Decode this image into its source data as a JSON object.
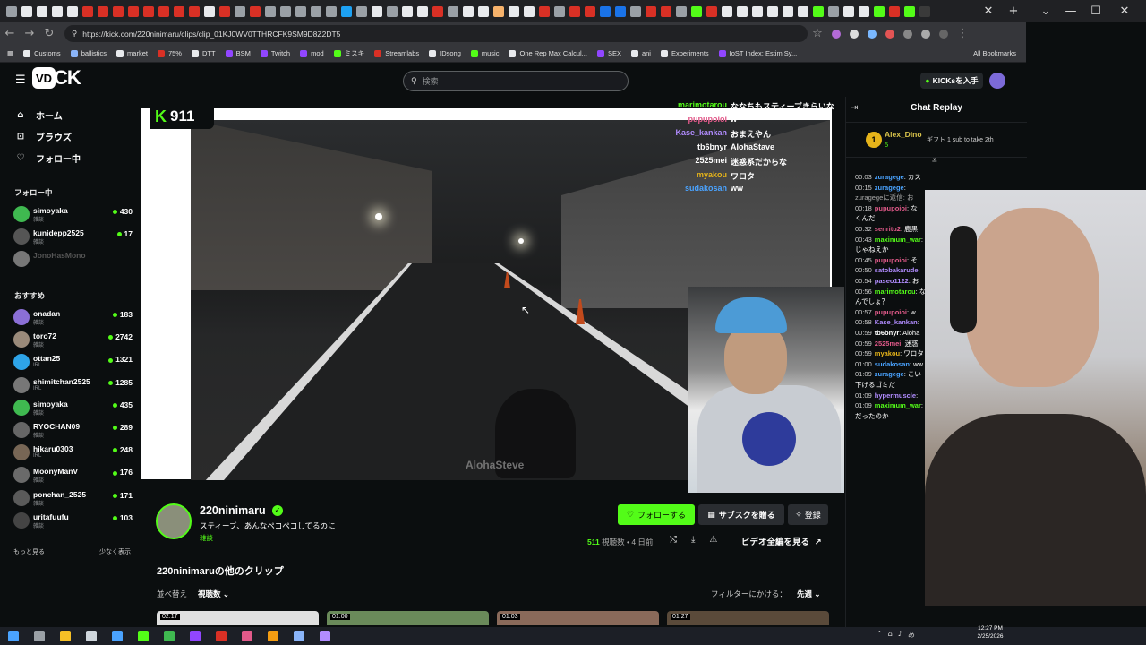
{
  "browser": {
    "url": "https://kick.com/220ninimaru/clips/clip_01KJ0WV0TTHRCFK9SM9D8Z2DT5",
    "bookmarks": [
      "Customs",
      "ballistics",
      "market",
      "75%",
      "DTT",
      "BSM",
      "Twitch",
      "mod",
      "ミスキ",
      "Streamlabs",
      "IDsong",
      "music",
      "One Rep Max Calcul...",
      "SEX",
      "ani",
      "Experiments",
      "IoST Index: Estim Sy..."
    ],
    "all_bookmarks": "All Bookmarks"
  },
  "kick": {
    "search_placeholder": "検索",
    "get_kicks": "KICKsを入手"
  },
  "sidebar": {
    "nav": [
      {
        "icon": "home-icon",
        "label": "ホーム"
      },
      {
        "icon": "browse-icon",
        "label": "ブラウズ"
      },
      {
        "icon": "heart-icon",
        "label": "フォロー中"
      }
    ],
    "following_title": "フォロー中",
    "following": [
      {
        "name": "simoyaka",
        "cat": "雑談",
        "viewers": "430"
      },
      {
        "name": "kunidepp2525",
        "cat": "雑談",
        "viewers": "17"
      },
      {
        "name": "JonoHasMono",
        "cat": "",
        "viewers": ""
      }
    ],
    "recommended_title": "おすすめ",
    "recommended": [
      {
        "name": "onadan",
        "cat": "雑談",
        "viewers": "183"
      },
      {
        "name": "toro72",
        "cat": "雑談",
        "viewers": "2742"
      },
      {
        "name": "ottan25",
        "cat": "IRL",
        "viewers": "1321"
      },
      {
        "name": "shimitchan2525",
        "cat": "IRL",
        "viewers": "1285"
      },
      {
        "name": "simoyaka",
        "cat": "雑談",
        "viewers": "435"
      },
      {
        "name": "RYOCHAN09",
        "cat": "雑談",
        "viewers": "289"
      },
      {
        "name": "hikaru0303",
        "cat": "IRL",
        "viewers": "248"
      },
      {
        "name": "MoonyManV",
        "cat": "雑談",
        "viewers": "176"
      },
      {
        "name": "ponchan_2525",
        "cat": "雑談",
        "viewers": "171"
      },
      {
        "name": "uritafuufu",
        "cat": "雑談",
        "viewers": "103"
      }
    ],
    "show_more": "もっと見る",
    "show_less": "少なく表示"
  },
  "video": {
    "kick_badge_number": "911",
    "watermark": "AlohaSteve",
    "overlay_chat": [
      {
        "user": "marimotarou",
        "msg": "ななちもスティーブきらいな",
        "color": "#53fc18"
      },
      {
        "user": "pupupoioi",
        "msg": "w",
        "color": "#e25a8a"
      },
      {
        "user": "Kase_kankan",
        "msg": "おまえやん",
        "color": "#b18cff"
      },
      {
        "user": "tb6bnyr",
        "msg": "AlohaStave",
        "color": "#ffffff"
      },
      {
        "user": "2525mei",
        "msg": "迷惑系だからな",
        "color": "#ffffff"
      },
      {
        "user": "myakou",
        "msg": "ワロタ",
        "color": "#e6b41a"
      },
      {
        "user": "sudakosan",
        "msg": "ww",
        "color": "#4aa3ff"
      }
    ]
  },
  "channel": {
    "name": "220ninimaru",
    "title": "スティーブ、あんなペコペコしてるのに",
    "category": "雑談",
    "follow": "フォローする",
    "gift_sub": "サブスクを贈る",
    "register": "登録",
    "views_count": "511",
    "views_label": "視聴数",
    "age": "• 4 日前",
    "full_video": "ビデオ全編を見る"
  },
  "clips": {
    "title": "220ninimaruの他のクリップ",
    "sort_label": "並べ替え",
    "sort_value": "視聴数",
    "filter_label": "フィルターにかける：",
    "filter_value": "先週",
    "thumbs": [
      "02:17",
      "01:00",
      "01:03",
      "01:27"
    ]
  },
  "chat": {
    "title": "Chat Replay",
    "pinned_user": "Alex_Dino",
    "pinned_count": "5",
    "pinned_badge": "1",
    "pinned_gift": "ギフト 1 sub to take 2th",
    "messages": [
      {
        "t": "00:03",
        "u": "zuragege",
        "m": "カス",
        "c": "#4aa3ff"
      },
      {
        "t": "00:15",
        "u": "zuragege",
        "m": "",
        "c": "#4aa3ff"
      },
      {
        "t": "",
        "u": "",
        "m": "zuragegeに返信: お",
        "c": "#aaa"
      },
      {
        "t": "00:18",
        "u": "pupupoioi",
        "m": "な",
        "c": "#e25a8a"
      },
      {
        "t": "",
        "u": "",
        "m": "くんだ",
        "c": "#fff"
      },
      {
        "t": "00:32",
        "u": "senritu2",
        "m": "鹿黒",
        "c": "#e25a8a"
      },
      {
        "t": "00:43",
        "u": "maximum_war",
        "m": "",
        "c": "#53fc18"
      },
      {
        "t": "",
        "u": "",
        "m": "じゃねえか",
        "c": "#fff"
      },
      {
        "t": "00:45",
        "u": "pupupoioi",
        "m": "そ",
        "c": "#e25a8a"
      },
      {
        "t": "00:50",
        "u": "satobakarude",
        "m": "",
        "c": "#b18cff"
      },
      {
        "t": "00:54",
        "u": "paseo1122",
        "m": "お",
        "c": "#b18cff"
      },
      {
        "t": "00:56",
        "u": "marimotarou",
        "m": "な",
        "c": "#53fc18"
      },
      {
        "t": "",
        "u": "",
        "m": "んでしょ？",
        "c": "#fff"
      },
      {
        "t": "00:57",
        "u": "pupupoioi",
        "m": "w",
        "c": "#e25a8a"
      },
      {
        "t": "00:58",
        "u": "Kase_kankan",
        "m": "",
        "c": "#b18cff"
      },
      {
        "t": "00:59",
        "u": "tb6bnyr",
        "m": "Aloha",
        "c": "#fff"
      },
      {
        "t": "00:59",
        "u": "2525mei",
        "m": "迷惑",
        "c": "#e25a8a"
      },
      {
        "t": "00:59",
        "u": "myakou",
        "m": "ワロタ",
        "c": "#e6b41a"
      },
      {
        "t": "01:00",
        "u": "sudakosan",
        "m": "ww",
        "c": "#4aa3ff"
      },
      {
        "t": "01:09",
        "u": "zuragege",
        "m": "こい",
        "c": "#4aa3ff"
      },
      {
        "t": "",
        "u": "",
        "m": "下げるゴミだ",
        "c": "#fff"
      },
      {
        "t": "01:09",
        "u": "hypermuscle",
        "m": "",
        "c": "#b18cff"
      },
      {
        "t": "01:09",
        "u": "maximum_war",
        "m": "",
        "c": "#53fc18"
      },
      {
        "t": "",
        "u": "",
        "m": "だったのか",
        "c": "#fff"
      }
    ]
  },
  "taskbar": {
    "time": "12:27 PM",
    "date": "2/25/2026"
  }
}
